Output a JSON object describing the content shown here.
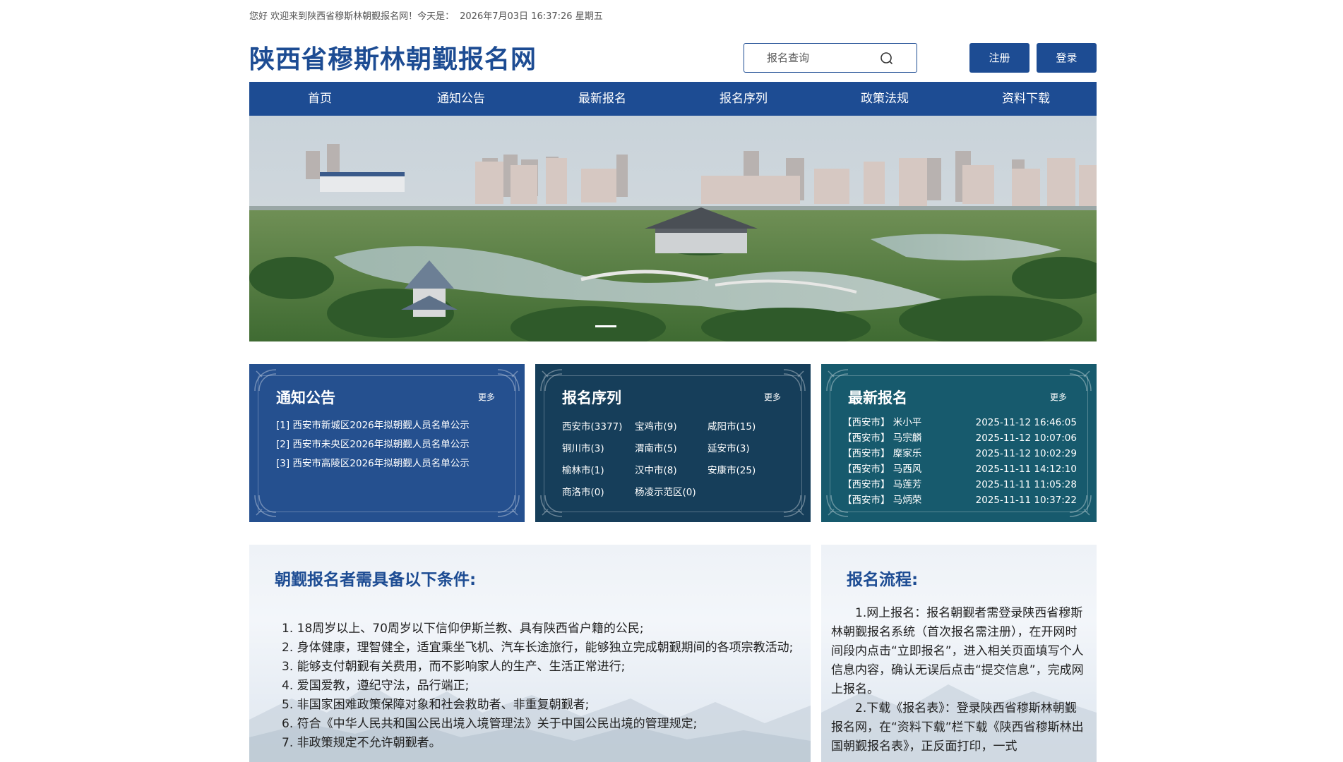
{
  "greeting": {
    "welcome": "您好 欢迎来到陕西省穆斯林朝觐报名网！今天是：",
    "datetime": "2026年7月03日 16:37:26 星期五"
  },
  "header": {
    "site_title": "陕西省穆斯林朝觐报名网",
    "search_placeholder": "报名查询",
    "register_label": "注册",
    "login_label": "登录"
  },
  "nav": [
    "首页",
    "通知公告",
    "最新报名",
    "报名序列",
    "政策法规",
    "资料下载"
  ],
  "banner": {
    "slides": 3,
    "active_slide": 1
  },
  "notices": {
    "title": "通知公告",
    "more": "更多",
    "items": [
      "[1] 西安市新城区2026年拟朝觐人员名单公示",
      "[2] 西安市未央区2026年拟朝觐人员名单公示",
      "[3] 西安市高陵区2026年拟朝觐人员名单公示"
    ]
  },
  "sequence": {
    "title": "报名序列",
    "more": "更多",
    "items": [
      "西安市(3377)",
      "宝鸡市(9)",
      "咸阳市(15)",
      "铜川市(3)",
      "渭南市(5)",
      "延安市(3)",
      "榆林市(1)",
      "汉中市(8)",
      "安康市(25)",
      "商洛市(0)",
      "杨凌示范区(0)"
    ]
  },
  "latest": {
    "title": "最新报名",
    "more": "更多",
    "items": [
      {
        "name": "【西安市】 米小平",
        "time": "2025-11-12 16:46:05"
      },
      {
        "name": "【西安市】 马宗麟",
        "time": "2025-11-12 10:07:06"
      },
      {
        "name": "【西安市】 糜家乐",
        "time": "2025-11-12 10:02:29"
      },
      {
        "name": "【西安市】 马西风",
        "time": "2025-11-11 14:12:10"
      },
      {
        "name": "【西安市】 马莲芳",
        "time": "2025-11-11 11:05:28"
      },
      {
        "name": "【西安市】 马炳荣",
        "time": "2025-11-11 10:37:22"
      }
    ]
  },
  "conditions": {
    "title": "朝觐报名者需具备以下条件:",
    "items": [
      "1. 18周岁以上、70周岁以下信仰伊斯兰教、具有陕西省户籍的公民;",
      "2. 身体健康，理智健全，适宜乘坐飞机、汽车长途旅行，能够独立完成朝觐期间的各项宗教活动;",
      "3. 能够支付朝觐有关费用，而不影响家人的生产、生活正常进行;",
      "4. 爱国爱教，遵纪守法，品行端正;",
      "5. 非国家困难政策保障对象和社会救助者、非重复朝觐者;",
      "6. 符合《中华人民共和国公民出境入境管理法》关于中国公民出境的管理规定;",
      "7. 非政策规定不允许朝觐者。"
    ]
  },
  "process": {
    "title": "报名流程:",
    "paragraphs": [
      "1.网上报名：报名朝觐者需登录陕西省穆斯林朝觐报名系统（首次报名需注册），在开网时间段内点击“立即报名”，进入相关页面填写个人信息内容，确认无误后点击“提交信息”，完成网上报名。",
      "2.下载《报名表》：登录陕西省穆斯林朝觐报名网，在“资料下载”栏下载《陕西省穆斯林出国朝觐报名表》，正反面打印，一式"
    ]
  },
  "colors": {
    "primary": "#1d4c93",
    "card_notice": "#25508f",
    "card_sequence": "#163e5a",
    "card_latest": "#175a6d"
  }
}
